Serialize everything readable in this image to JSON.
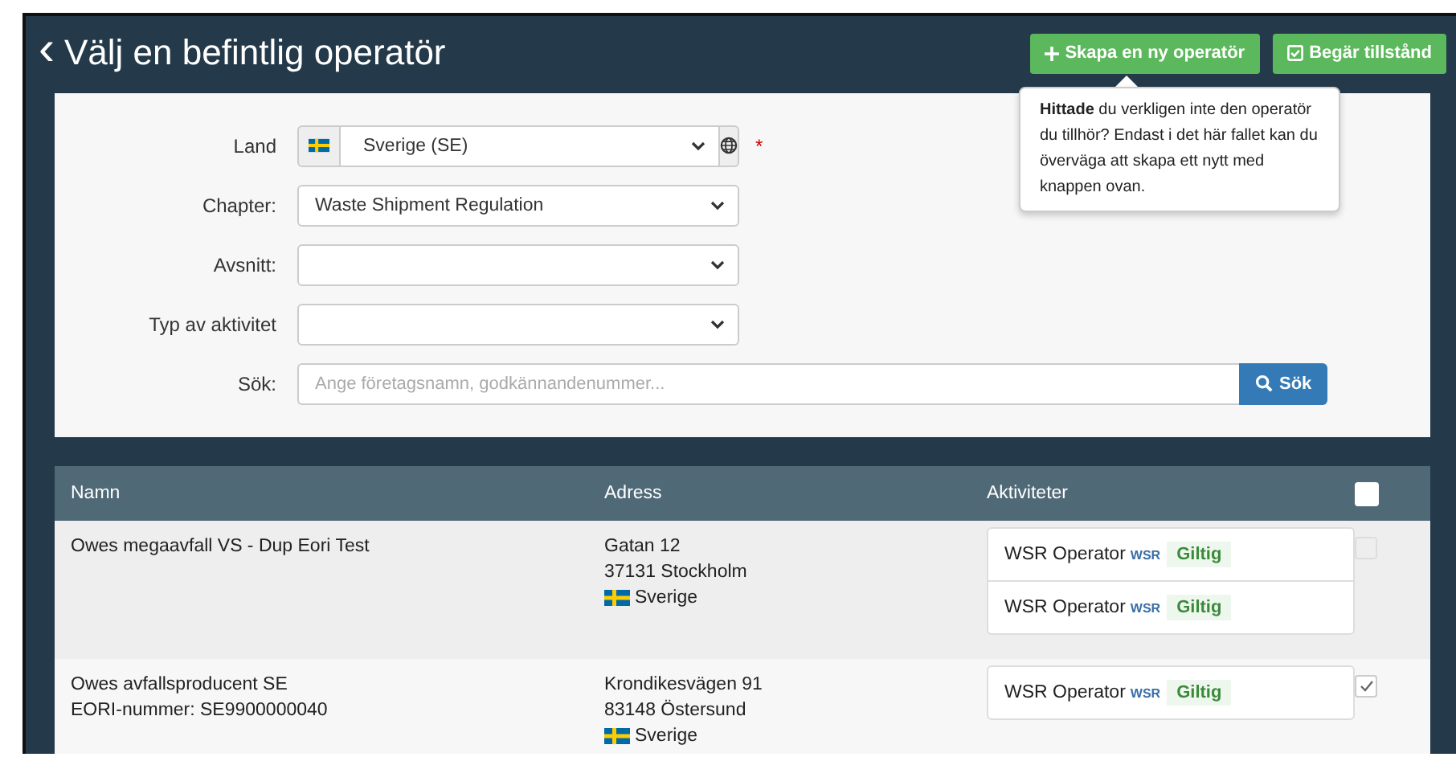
{
  "header": {
    "back": "‹",
    "title": "Välj en befintlig operatör"
  },
  "buttons": [
    {
      "kind": "plus",
      "label": "Skapa en ny operatör"
    },
    {
      "kind": "check",
      "label": "Begär tillstånd"
    }
  ],
  "tooltip": {
    "text": "**Hittade** du verkligen inte den operatör du tillhör? Endast i det här fallet kan du överväga att skapa ett nytt med knappen ovan."
  },
  "form": {
    "fields": [
      {
        "kind": "country",
        "label": "Land",
        "value": "Sverige (SE)",
        "required_mark": "*"
      },
      {
        "kind": "select",
        "label": "Chapter:",
        "value": "Waste Shipment Regulation"
      },
      {
        "kind": "select",
        "label": "Avsnitt:"
      },
      {
        "kind": "select",
        "label": "Typ av aktivitet"
      },
      {
        "kind": "search",
        "label": "Sök:",
        "placeholder": "Ange företagsnamn, godkännandenummer...",
        "button": "Sök"
      }
    ]
  },
  "table": {
    "columns": [
      "Namn",
      "Adress",
      "Aktiviteter"
    ],
    "select_all": {
      "checked": false
    },
    "rows": [
      {
        "name": [
          "Owes megaavfall VS - Dup Eori Test"
        ],
        "address": [
          "Gatan 12",
          "37131 Stockholm"
        ],
        "country": "Sverige",
        "activities": [
          {
            "name": "WSR Operator",
            "code": "WSR",
            "status": "Giltig"
          },
          {
            "name": "WSR Operator",
            "code": "WSR",
            "status": "Giltig"
          }
        ],
        "checked": false,
        "disabled": true
      },
      {
        "name": [
          "Owes avfallsproducent SE",
          "EORI-nummer: SE9900000040"
        ],
        "address": [
          "Krondikesvägen 91",
          "83148 Östersund"
        ],
        "country": "Sverige",
        "activities": [
          {
            "name": "WSR Operator",
            "code": "WSR",
            "status": "Giltig"
          }
        ],
        "checked": true,
        "disabled": false
      }
    ]
  }
}
